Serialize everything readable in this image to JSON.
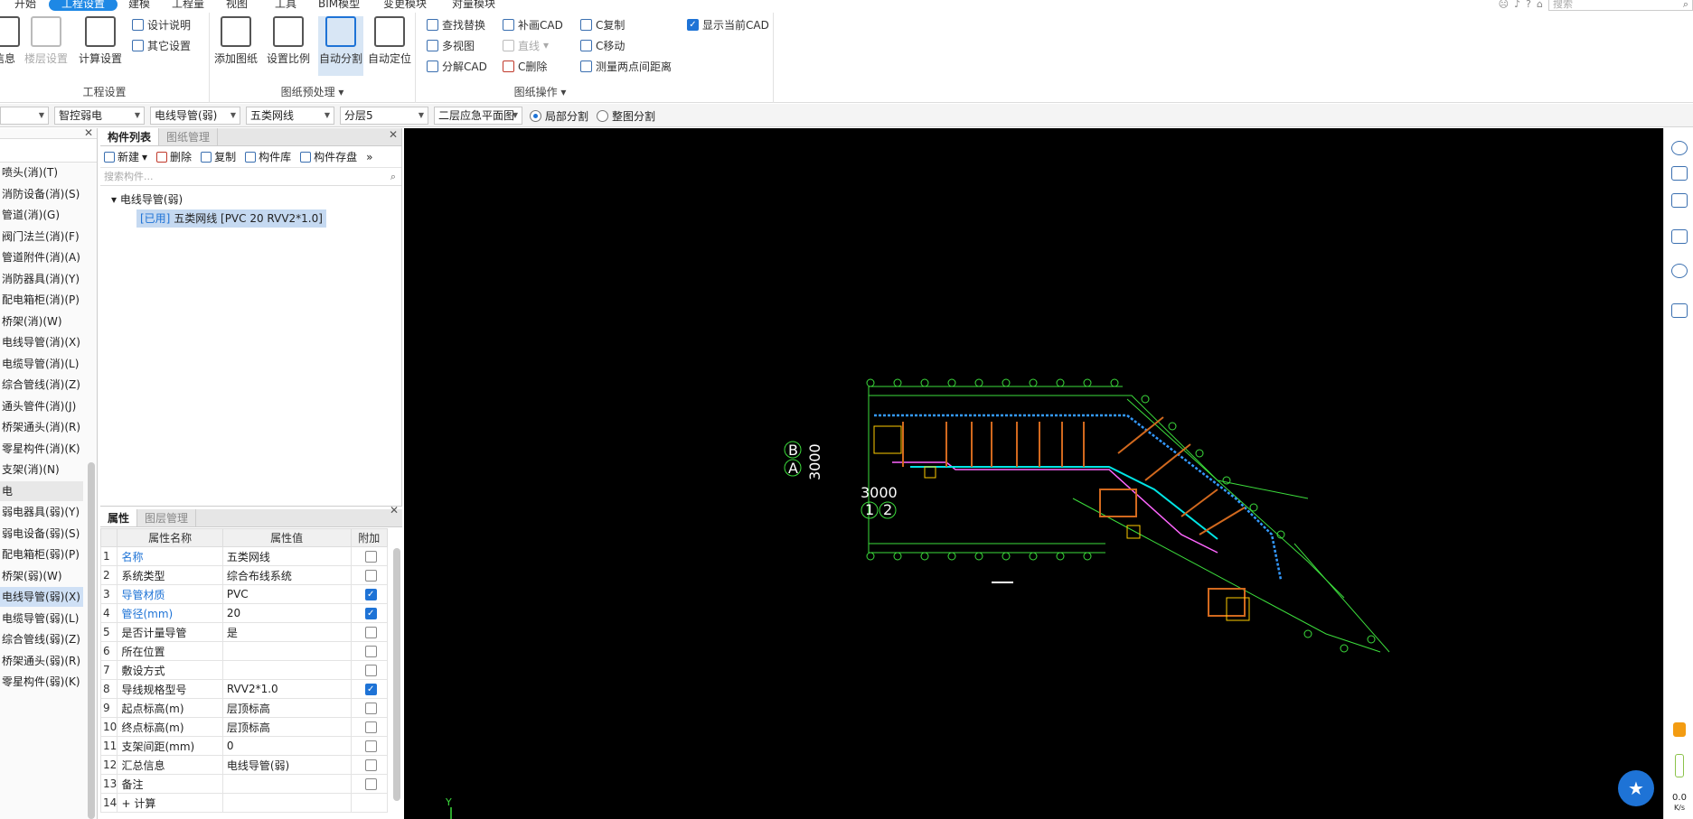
{
  "menu": [
    "开始",
    "工程设置",
    "建模",
    "工程量",
    "视图",
    "工具",
    "BIM模型",
    "变更模块",
    "对量模块"
  ],
  "search_placeholder": "搜索",
  "ribbon": {
    "gc_group_label": "工程设置",
    "gc_buttons": [
      "信息",
      "楼层设置",
      "计算设置"
    ],
    "gc_small": [
      "设计说明",
      "其它设置"
    ],
    "pre_group_label": "图纸预处理",
    "pre_buttons": [
      "添加图纸",
      "设置比例",
      "自动分割",
      "自动定位"
    ],
    "ops_group_label": "图纸操作",
    "ops_col1": [
      "查找替换",
      "多视图",
      "分解CAD"
    ],
    "ops_col2": [
      "补画CAD",
      "直线",
      "C删除"
    ],
    "ops_col3": [
      "C复制",
      "C移动",
      "测量两点间距离"
    ],
    "show_cad": "显示当前CAD"
  },
  "toolbar2": {
    "combos": [
      "智控弱电",
      "电线导管(弱)",
      "五类网线",
      "分层5",
      "二层应急平面图"
    ],
    "radio_local": "局部分割",
    "radio_whole": "整图分割"
  },
  "left_items": [
    "喷头(消)(T)",
    "消防设备(消)(S)",
    "管道(消)(G)",
    "阀门法兰(消)(F)",
    "管道附件(消)(A)",
    "消防器具(消)(Y)",
    "配电箱柜(消)(P)",
    "桥架(消)(W)",
    "电线导管(消)(X)",
    "电缆导管(消)(L)",
    "综合管线(消)(Z)",
    "通头管件(消)(J)",
    "桥架通头(消)(R)",
    "零星构件(消)(K)",
    "支架(消)(N)",
    "电",
    "弱电器具(弱)(Y)",
    "弱电设备(弱)(S)",
    "配电箱柜(弱)(P)",
    "桥架(弱)(W)",
    "电线导管(弱)(X)",
    "电缆导管(弱)(L)",
    "综合管线(弱)(Z)",
    "桥架通头(弱)(R)",
    "零星构件(弱)(K)"
  ],
  "component": {
    "tabs": [
      "构件列表",
      "图纸管理"
    ],
    "tools": [
      "新建",
      "删除",
      "复制",
      "构件库",
      "构件存盘"
    ],
    "search_placeholder": "搜索构件...",
    "tree_root": "电线导管(弱)",
    "leaf_used": "[已用]",
    "leaf_name": "五类网线 [PVC 20 RVV2*1.0]"
  },
  "props": {
    "tabs": [
      "属性",
      "图层管理"
    ],
    "headers": [
      "属性名称",
      "属性值",
      "附加"
    ],
    "rows": [
      {
        "n": "1",
        "name": "名称",
        "val": "五类网线",
        "blue": true,
        "cb": false
      },
      {
        "n": "2",
        "name": "系统类型",
        "val": "综合布线系统",
        "blue": false,
        "cb": false
      },
      {
        "n": "3",
        "name": "导管材质",
        "val": "PVC",
        "blue": true,
        "cb": true
      },
      {
        "n": "4",
        "name": "管径(mm)",
        "val": "20",
        "blue": true,
        "cb": true
      },
      {
        "n": "5",
        "name": "是否计量导管",
        "val": "是",
        "blue": false,
        "cb": false
      },
      {
        "n": "6",
        "name": "所在位置",
        "val": "",
        "blue": false,
        "cb": false
      },
      {
        "n": "7",
        "name": "敷设方式",
        "val": "",
        "blue": false,
        "cb": false
      },
      {
        "n": "8",
        "name": "导线规格型号",
        "val": "RVV2*1.0",
        "blue": false,
        "cb": true
      },
      {
        "n": "9",
        "name": "起点标高(m)",
        "val": "层顶标高",
        "blue": false,
        "cb": false
      },
      {
        "n": "10",
        "name": "终点标高(m)",
        "val": "层顶标高",
        "blue": false,
        "cb": false
      },
      {
        "n": "11",
        "name": "支架间距(mm)",
        "val": "0",
        "blue": false,
        "cb": false
      },
      {
        "n": "12",
        "name": "汇总信息",
        "val": "电线导管(弱)",
        "blue": false,
        "cb": false
      },
      {
        "n": "13",
        "name": "备注",
        "val": "",
        "blue": false,
        "cb": false
      },
      {
        "n": "14",
        "name": "+ 计算",
        "val": "",
        "blue": false,
        "cb": null
      }
    ]
  },
  "canvas": {
    "label_3000a": "3000",
    "label_3000b": "3000",
    "label_B": "B",
    "label_A": "A",
    "label_1": "1",
    "label_2": "2",
    "axis_y": "Y"
  },
  "speed": {
    "value": "0.0",
    "unit": "K/s"
  }
}
